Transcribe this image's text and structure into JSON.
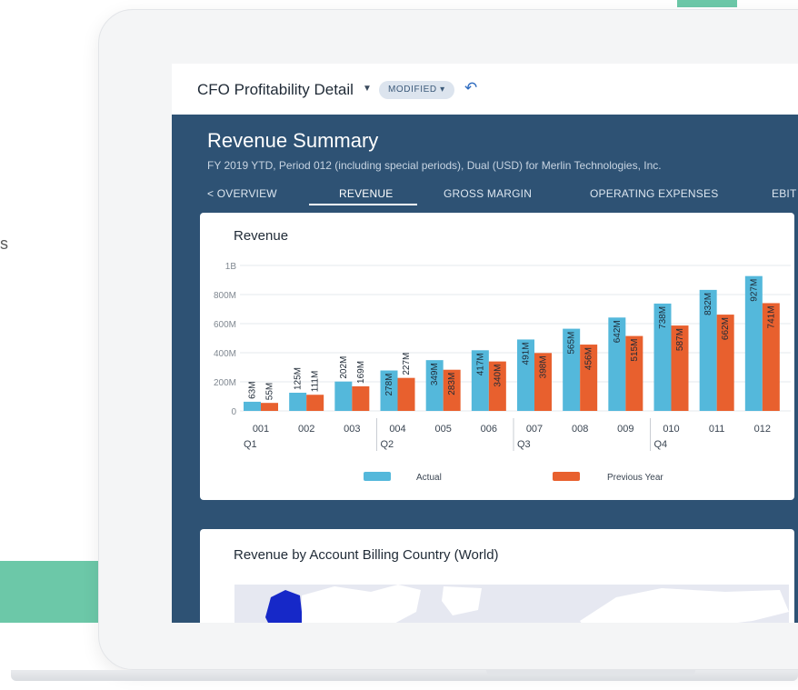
{
  "background_glyph": "s",
  "app": {
    "title": "CFO Profitability Detail",
    "title_dropdown_icon": "caret-down-icon",
    "status_badge": "MODIFIED ▾",
    "undo_icon": "undo-icon"
  },
  "header": {
    "title": "Revenue Summary",
    "subtitle": "FY 2019 YTD, Period 012 (including special periods), Dual (USD) for Merlin Technologies, Inc."
  },
  "tabs": [
    {
      "label": "< OVERVIEW",
      "active": false
    },
    {
      "label": "REVENUE",
      "active": true
    },
    {
      "label": "GROSS MARGIN",
      "active": false
    },
    {
      "label": "OPERATING EXPENSES",
      "active": false
    },
    {
      "label": "EBIT",
      "active": false
    }
  ],
  "revenue_card": {
    "title": "Revenue"
  },
  "map_card": {
    "title": "Revenue by Account Billing Country (World)"
  },
  "colors": {
    "actual": "#54b8db",
    "previous_year": "#e8602e",
    "hero_bg": "#2e5274",
    "map_highlight": "#1628c8"
  },
  "chart_data": {
    "type": "bar",
    "title": "Revenue",
    "xlabel": "",
    "ylabel": "",
    "ylim": [
      0,
      1000
    ],
    "unit": "M",
    "y_ticks": [
      "0",
      "200M",
      "400M",
      "600M",
      "800M",
      "1B"
    ],
    "categories": [
      "001",
      "002",
      "003",
      "004",
      "005",
      "006",
      "007",
      "008",
      "009",
      "010",
      "011",
      "012"
    ],
    "groups": [
      {
        "label": "Q1",
        "categories": [
          "001",
          "002",
          "003"
        ]
      },
      {
        "label": "Q2",
        "categories": [
          "004",
          "005",
          "006"
        ]
      },
      {
        "label": "Q3",
        "categories": [
          "007",
          "008",
          "009"
        ]
      },
      {
        "label": "Q4",
        "categories": [
          "010",
          "011",
          "012"
        ]
      }
    ],
    "series": [
      {
        "name": "Actual",
        "values": [
          63,
          125,
          202,
          278,
          349,
          417,
          491,
          565,
          642,
          738,
          832,
          927
        ],
        "labels": [
          "63M",
          "125M",
          "202M",
          "278M",
          "349M",
          "417M",
          "491M",
          "565M",
          "642M",
          "738M",
          "832M",
          "927M"
        ]
      },
      {
        "name": "Previous Year",
        "values": [
          55,
          111,
          169,
          227,
          283,
          340,
          398,
          456,
          515,
          587,
          662,
          741
        ],
        "labels": [
          "55M",
          "111M",
          "169M",
          "227M",
          "283M",
          "340M",
          "398M",
          "456M",
          "515M",
          "587M",
          "662M",
          "741M"
        ]
      }
    ],
    "legend_position": "bottom",
    "grid": true
  }
}
